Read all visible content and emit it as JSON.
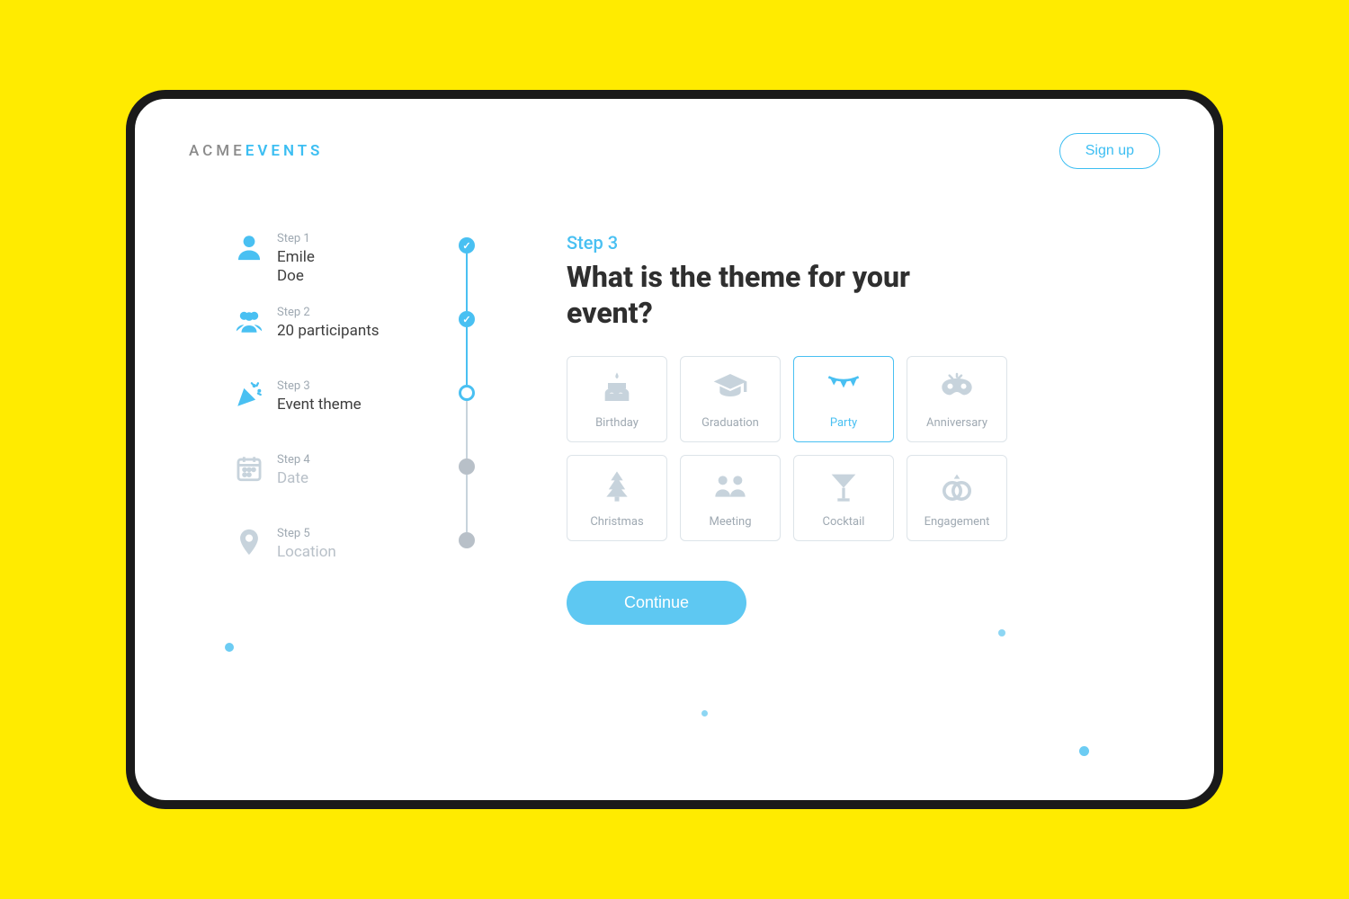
{
  "brand": {
    "part1": "ACME",
    "part2": "EVENTS"
  },
  "header": {
    "signup": "Sign up"
  },
  "stepper": {
    "items": [
      {
        "label": "Step 1",
        "value": "Emile\nDoe",
        "icon": "user-icon",
        "status": "complete"
      },
      {
        "label": "Step 2",
        "value": "20 participants",
        "icon": "group-icon",
        "status": "complete"
      },
      {
        "label": "Step 3",
        "value": "Event theme",
        "icon": "party-popper-icon",
        "status": "current"
      },
      {
        "label": "Step 4",
        "value": "Date",
        "icon": "calendar-icon",
        "status": "inactive"
      },
      {
        "label": "Step 5",
        "value": "Location",
        "icon": "pin-icon",
        "status": "inactive"
      }
    ]
  },
  "main": {
    "step_indicator": "Step 3",
    "question": "What is the theme for your event?",
    "themes": [
      {
        "label": "Birthday",
        "icon": "cake-icon",
        "selected": false
      },
      {
        "label": "Graduation",
        "icon": "graduation-icon",
        "selected": false
      },
      {
        "label": "Party",
        "icon": "flags-icon",
        "selected": true
      },
      {
        "label": "Anniversary",
        "icon": "mask-icon",
        "selected": false
      },
      {
        "label": "Christmas",
        "icon": "tree-icon",
        "selected": false
      },
      {
        "label": "Meeting",
        "icon": "meeting-icon",
        "selected": false
      },
      {
        "label": "Cocktail",
        "icon": "cocktail-icon",
        "selected": false
      },
      {
        "label": "Engagement",
        "icon": "rings-icon",
        "selected": false
      }
    ],
    "continue": "Continue"
  },
  "colors": {
    "accent": "#49C0F2",
    "frame_bg": "#FFEB00"
  }
}
